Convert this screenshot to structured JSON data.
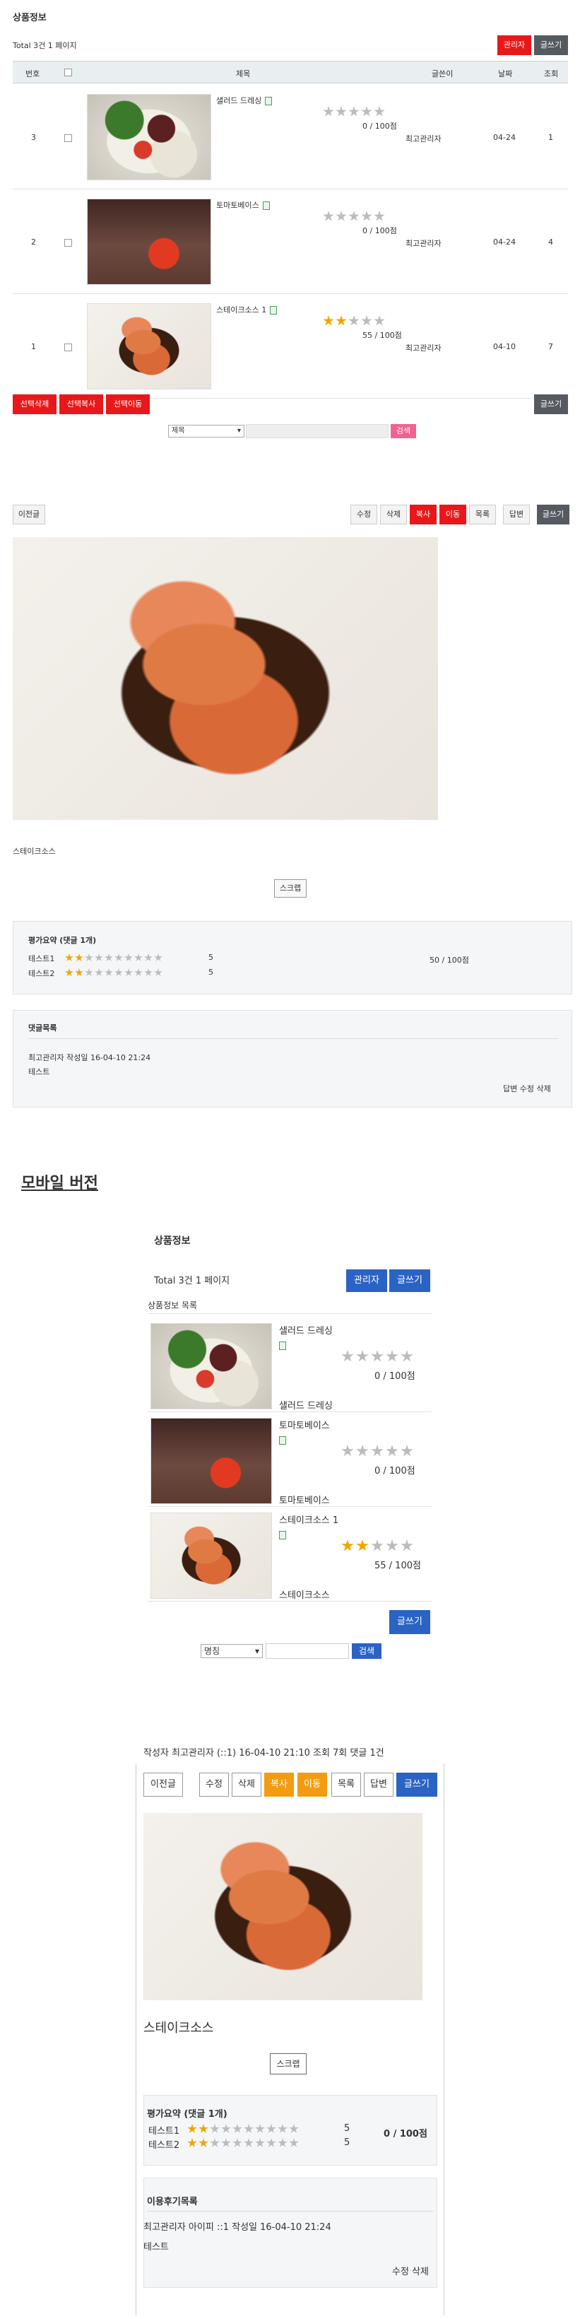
{
  "board": {
    "title": "상품정보",
    "total_text": "Total 3건 1 페이지",
    "admin_button": "관리자",
    "write_button": "글쓰기",
    "headers": [
      "번호",
      "",
      "제목",
      "글쓴이",
      "날짜",
      "조회"
    ],
    "rows": [
      {
        "num": "3",
        "title": "샐러드 드레싱",
        "score_text": "0 / 100점",
        "stars": 0,
        "author": "최고관리자",
        "date": "04-24",
        "hits": "1",
        "image": "salad"
      },
      {
        "num": "2",
        "title": "토마토베이스",
        "score_text": "0 / 100점",
        "stars": 0,
        "author": "최고관리자",
        "date": "04-24",
        "hits": "4",
        "image": "tomato"
      },
      {
        "num": "1",
        "title": "스테이크소스 1",
        "score_text": "55 / 100점",
        "stars": 2,
        "author": "최고관리자",
        "date": "04-10",
        "hits": "7",
        "image": "salmon"
      }
    ],
    "bulk_buttons": [
      "선택삭제",
      "선택복사",
      "선택이동"
    ],
    "write_button_bottom": "글쓰기",
    "search_select": "제목",
    "search_button": "검색"
  },
  "view": {
    "prev_button": "이전글",
    "buttons": [
      "수정",
      "삭제",
      "복사",
      "이동",
      "목록",
      "답변",
      "글쓰기"
    ],
    "caption": "스테이크소스",
    "scrap_button": "스크랩",
    "rating_title": "평가요약 (댓글 1개)",
    "ratings": [
      {
        "name": "테스트1",
        "stars": 2,
        "score": "5"
      },
      {
        "name": "테스트2",
        "stars": 2,
        "score": "5"
      }
    ],
    "rating_total": "50 / 100점",
    "comment_title": "댓글목록",
    "comment_meta": "최고관리자 작성일  16-04-10 21:24",
    "comment_text": "테스트",
    "comment_actions": "답변 수정 삭제"
  },
  "mobile_heading": "모바일 버전",
  "mobile_list": {
    "title": "상품정보",
    "total_text": "Total 3건 1 페이지",
    "admin_button": "관리자",
    "write_button": "글쓰기",
    "list_caption": "상품정보 목록",
    "items": [
      {
        "title": "샐러드 드레싱",
        "score_text": "0 / 100점",
        "stars": 0,
        "subtitle": "샐러드 드레싱",
        "image": "salad"
      },
      {
        "title": "토마토베이스",
        "score_text": "0 / 100점",
        "stars": 0,
        "subtitle": "토마토베이스",
        "image": "tomato"
      },
      {
        "title": "스테이크소스 1",
        "score_text": "55 / 100점",
        "stars": 2,
        "subtitle": "스테이크소스",
        "image": "salmon"
      }
    ],
    "write_button_bottom": "글쓰기",
    "search_select": "명칭",
    "search_button": "검색"
  },
  "mobile_view": {
    "meta": "작성자  최고관리자 (::1)  16-04-10 21:10 조회 7회 댓글 1건",
    "prev_button": "이전글",
    "buttons": [
      "수정",
      "삭제",
      "복사",
      "이동",
      "목록",
      "답변",
      "글쓰기"
    ],
    "title": "스테이크소스",
    "scrap_button": "스크랩",
    "rating_title": "평가요약 (댓글 1개)",
    "ratings": [
      {
        "name": "테스트1",
        "stars": 2,
        "score": "5"
      },
      {
        "name": "테스트2",
        "stars": 2,
        "score": "5"
      }
    ],
    "rating_total": "0 / 100점",
    "comment_title": "이용후기목록",
    "comment_meta": "최고관리자 아이피  ::1   작성일  16-04-10 21:24",
    "comment_text": "테스트",
    "comment_actions": "수정 삭제"
  },
  "colors": {
    "red": "#e8181a",
    "dark": "#545a60",
    "blue": "#2a63c4",
    "orange": "#f39c12",
    "star": "#f0a500"
  }
}
